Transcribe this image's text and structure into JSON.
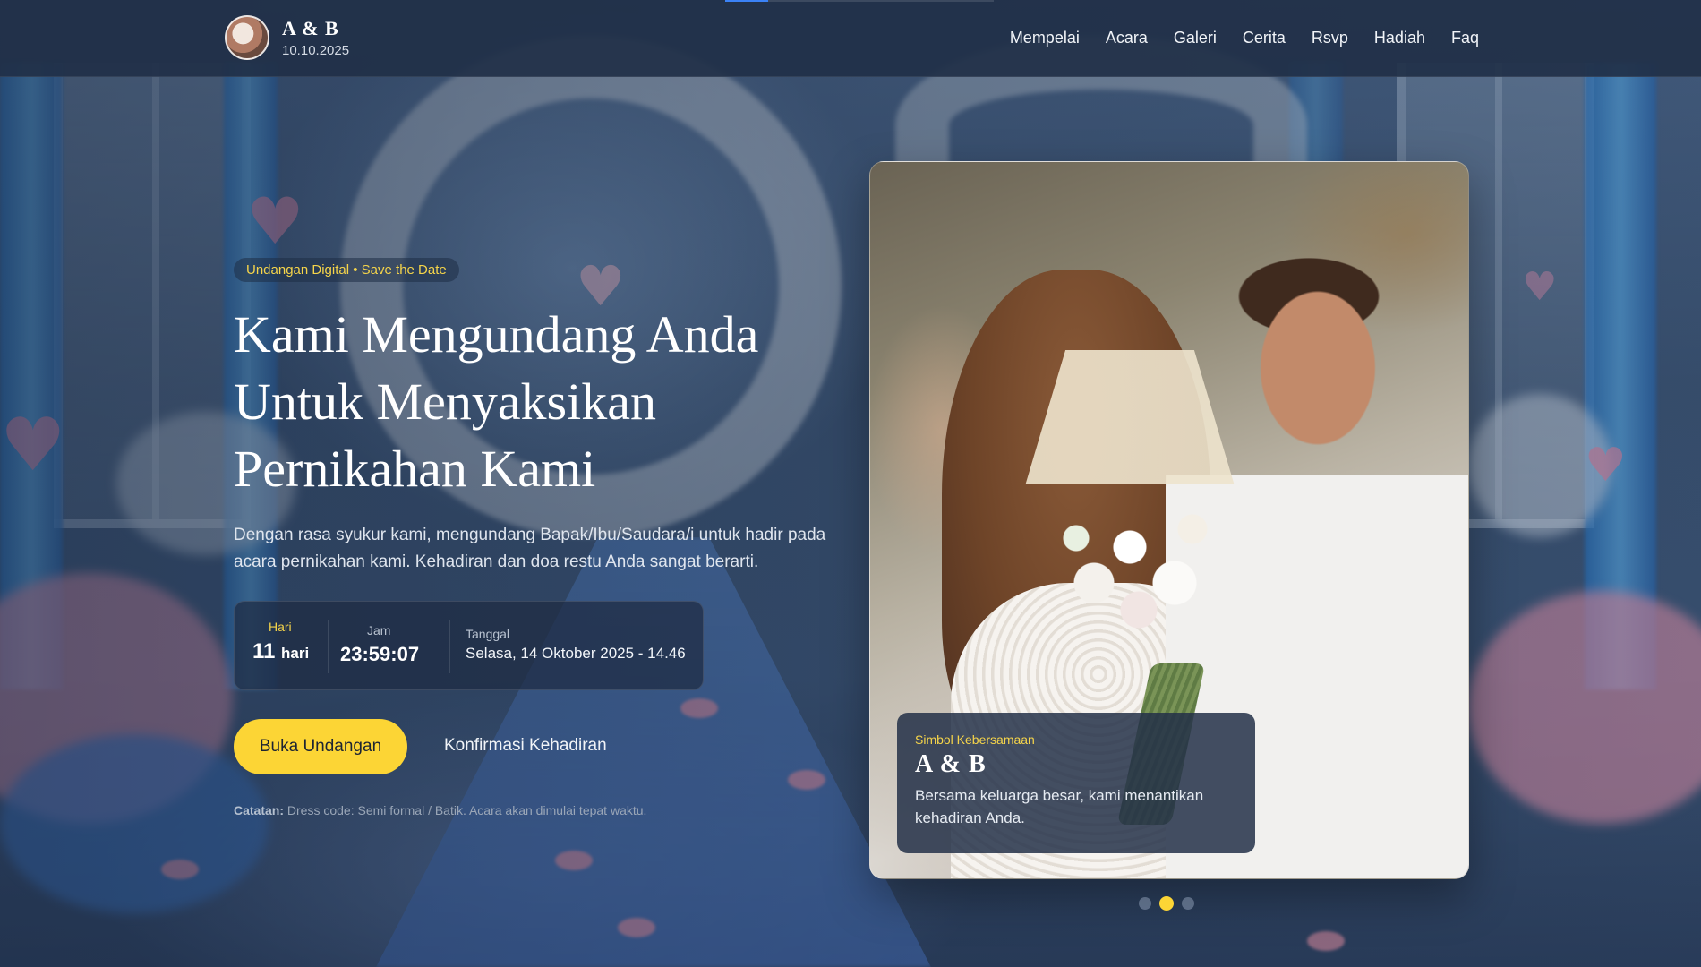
{
  "header": {
    "brand_name": "A & B",
    "brand_date": "10.10.2025",
    "nav": [
      "Mempelai",
      "Acara",
      "Galeri",
      "Cerita",
      "Rsvp",
      "Hadiah",
      "Faq"
    ],
    "scroll_progress_fraction": 0.16
  },
  "hero": {
    "badge": "Undangan Digital • Save the Date",
    "title_lines": [
      "Kami Mengundang Anda",
      "Untuk Menyaksikan",
      "Pernikahan Kami"
    ],
    "subtitle": "Dengan rasa syukur kami, mengundang Bapak/Ibu/Saudara/i untuk hadir pada acara pernikahan kami. Kehadiran dan doa restu Anda sangat berarti.",
    "countdown": {
      "days_label": "Hari",
      "days_value": "11",
      "days_unit": "hari",
      "time_label": "Jam",
      "time_value": "23:59:07",
      "date_label": "Tanggal",
      "date_value": "Selasa, 14 Oktober 2025 - 14.46"
    },
    "primary_button": "Buka Undangan",
    "secondary_link": "Konfirmasi Kehadiran",
    "note_label": "Catatan:",
    "note_text": " Dress code: Semi formal / Batik. Acara akan dimulai tepat waktu."
  },
  "card": {
    "caption_label": "Simbol Kebersamaan",
    "caption_title": "A & B",
    "caption_text": "Bersama keluarga besar, kami menantikan kehadiran Anda."
  },
  "carousel": {
    "slide_count": 3,
    "active_index": 1
  },
  "colors": {
    "accent": "#fcd535",
    "progress": "#3b82f6",
    "header_bg": "#213048"
  }
}
